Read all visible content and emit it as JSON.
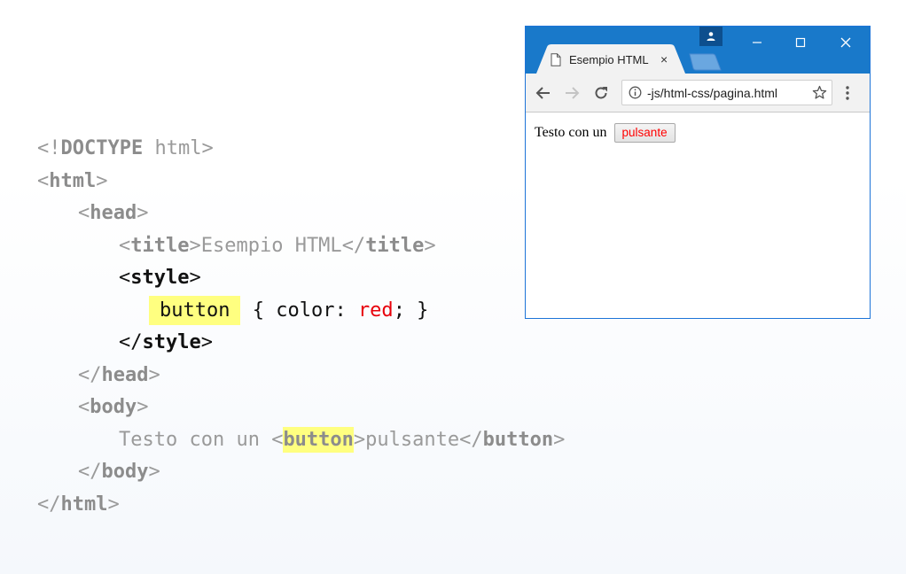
{
  "code": {
    "doctype_open": "<!",
    "doctype_kw": "DOCTYPE",
    "doctype_rest": " html>",
    "html_tag": "html",
    "head_tag": "head",
    "title_tag": "title",
    "title_text": "Esempio HTML",
    "style_tag": "style",
    "css_selector": "button",
    "css_prop": " { color: ",
    "css_value": "red",
    "css_end": "; }",
    "body_tag": "body",
    "body_text": "Testo con un ",
    "button_tag": "button",
    "button_text": "pulsante"
  },
  "browser": {
    "tab_title": "Esempio HTML",
    "tab_close": "×",
    "url": "-js/html-css/pagina.html",
    "page_text": "Testo con un",
    "page_button": "pulsante"
  },
  "colors": {
    "highlight": "#ffff80",
    "css_value": "#e8000b",
    "titlebar": "#1979ca",
    "button_text": "#ff0000"
  }
}
